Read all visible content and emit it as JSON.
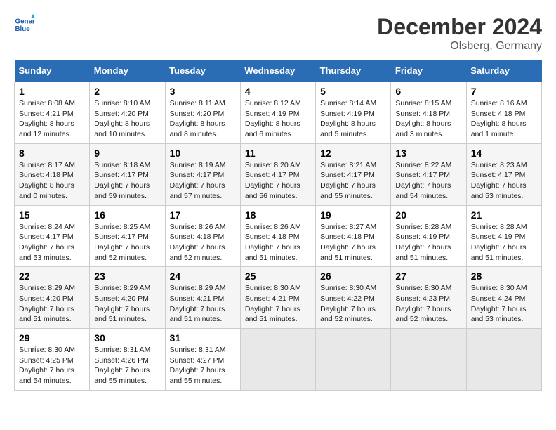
{
  "header": {
    "logo_line1": "General",
    "logo_line2": "Blue",
    "month_title": "December 2024",
    "location": "Olsberg, Germany"
  },
  "days_of_week": [
    "Sunday",
    "Monday",
    "Tuesday",
    "Wednesday",
    "Thursday",
    "Friday",
    "Saturday"
  ],
  "weeks": [
    [
      {
        "day": 1,
        "sunrise": "8:08 AM",
        "sunset": "4:21 PM",
        "daylight": "8 hours and 12 minutes."
      },
      {
        "day": 2,
        "sunrise": "8:10 AM",
        "sunset": "4:20 PM",
        "daylight": "8 hours and 10 minutes."
      },
      {
        "day": 3,
        "sunrise": "8:11 AM",
        "sunset": "4:20 PM",
        "daylight": "8 hours and 8 minutes."
      },
      {
        "day": 4,
        "sunrise": "8:12 AM",
        "sunset": "4:19 PM",
        "daylight": "8 hours and 6 minutes."
      },
      {
        "day": 5,
        "sunrise": "8:14 AM",
        "sunset": "4:19 PM",
        "daylight": "8 hours and 5 minutes."
      },
      {
        "day": 6,
        "sunrise": "8:15 AM",
        "sunset": "4:18 PM",
        "daylight": "8 hours and 3 minutes."
      },
      {
        "day": 7,
        "sunrise": "8:16 AM",
        "sunset": "4:18 PM",
        "daylight": "8 hours and 1 minute."
      }
    ],
    [
      {
        "day": 8,
        "sunrise": "8:17 AM",
        "sunset": "4:18 PM",
        "daylight": "8 hours and 0 minutes."
      },
      {
        "day": 9,
        "sunrise": "8:18 AM",
        "sunset": "4:17 PM",
        "daylight": "7 hours and 59 minutes."
      },
      {
        "day": 10,
        "sunrise": "8:19 AM",
        "sunset": "4:17 PM",
        "daylight": "7 hours and 57 minutes."
      },
      {
        "day": 11,
        "sunrise": "8:20 AM",
        "sunset": "4:17 PM",
        "daylight": "7 hours and 56 minutes."
      },
      {
        "day": 12,
        "sunrise": "8:21 AM",
        "sunset": "4:17 PM",
        "daylight": "7 hours and 55 minutes."
      },
      {
        "day": 13,
        "sunrise": "8:22 AM",
        "sunset": "4:17 PM",
        "daylight": "7 hours and 54 minutes."
      },
      {
        "day": 14,
        "sunrise": "8:23 AM",
        "sunset": "4:17 PM",
        "daylight": "7 hours and 53 minutes."
      }
    ],
    [
      {
        "day": 15,
        "sunrise": "8:24 AM",
        "sunset": "4:17 PM",
        "daylight": "7 hours and 53 minutes."
      },
      {
        "day": 16,
        "sunrise": "8:25 AM",
        "sunset": "4:17 PM",
        "daylight": "7 hours and 52 minutes."
      },
      {
        "day": 17,
        "sunrise": "8:26 AM",
        "sunset": "4:18 PM",
        "daylight": "7 hours and 52 minutes."
      },
      {
        "day": 18,
        "sunrise": "8:26 AM",
        "sunset": "4:18 PM",
        "daylight": "7 hours and 51 minutes."
      },
      {
        "day": 19,
        "sunrise": "8:27 AM",
        "sunset": "4:18 PM",
        "daylight": "7 hours and 51 minutes."
      },
      {
        "day": 20,
        "sunrise": "8:28 AM",
        "sunset": "4:19 PM",
        "daylight": "7 hours and 51 minutes."
      },
      {
        "day": 21,
        "sunrise": "8:28 AM",
        "sunset": "4:19 PM",
        "daylight": "7 hours and 51 minutes."
      }
    ],
    [
      {
        "day": 22,
        "sunrise": "8:29 AM",
        "sunset": "4:20 PM",
        "daylight": "7 hours and 51 minutes."
      },
      {
        "day": 23,
        "sunrise": "8:29 AM",
        "sunset": "4:20 PM",
        "daylight": "7 hours and 51 minutes."
      },
      {
        "day": 24,
        "sunrise": "8:29 AM",
        "sunset": "4:21 PM",
        "daylight": "7 hours and 51 minutes."
      },
      {
        "day": 25,
        "sunrise": "8:30 AM",
        "sunset": "4:21 PM",
        "daylight": "7 hours and 51 minutes."
      },
      {
        "day": 26,
        "sunrise": "8:30 AM",
        "sunset": "4:22 PM",
        "daylight": "7 hours and 52 minutes."
      },
      {
        "day": 27,
        "sunrise": "8:30 AM",
        "sunset": "4:23 PM",
        "daylight": "7 hours and 52 minutes."
      },
      {
        "day": 28,
        "sunrise": "8:30 AM",
        "sunset": "4:24 PM",
        "daylight": "7 hours and 53 minutes."
      }
    ],
    [
      {
        "day": 29,
        "sunrise": "8:30 AM",
        "sunset": "4:25 PM",
        "daylight": "7 hours and 54 minutes."
      },
      {
        "day": 30,
        "sunrise": "8:31 AM",
        "sunset": "4:26 PM",
        "daylight": "7 hours and 55 minutes."
      },
      {
        "day": 31,
        "sunrise": "8:31 AM",
        "sunset": "4:27 PM",
        "daylight": "7 hours and 55 minutes."
      },
      null,
      null,
      null,
      null
    ]
  ],
  "labels": {
    "sunrise": "Sunrise:",
    "sunset": "Sunset:",
    "daylight": "Daylight:"
  }
}
